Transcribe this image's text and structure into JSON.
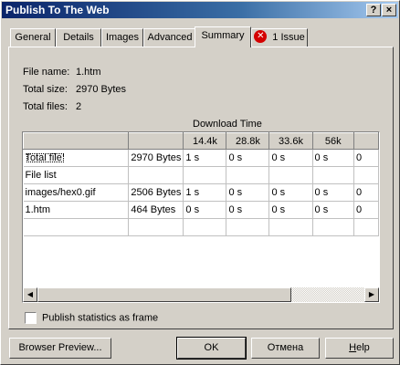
{
  "window": {
    "title": "Publish To The Web",
    "help_button": "?",
    "close_button": "×"
  },
  "tabs": [
    "General",
    "Details",
    "Images",
    "Advanced",
    "Summary"
  ],
  "issue_tab": {
    "icon": "error-icon",
    "label": "1 Issue"
  },
  "summary": {
    "file_name": {
      "label": "File name:",
      "value": "1.htm"
    },
    "total_size": {
      "label": "Total size:",
      "value": "2970 Bytes"
    },
    "total_files": {
      "label": "Total files:",
      "value": "2"
    }
  },
  "download_time_label": "Download Time",
  "table": {
    "headers": [
      "",
      "",
      "14.4k",
      "28.8k",
      "33.6k",
      "56k",
      ""
    ],
    "rows": [
      [
        "Total file:",
        "2970 Bytes",
        "1 s",
        "0 s",
        "0 s",
        "0 s",
        "0"
      ],
      [
        "File list",
        "",
        "",
        "",
        "",
        "",
        ""
      ],
      [
        "images/hex0.gif",
        "2506 Bytes",
        "1 s",
        "0 s",
        "0 s",
        "0 s",
        "0"
      ],
      [
        "1.htm",
        "464 Bytes",
        "0 s",
        "0 s",
        "0 s",
        "0 s",
        "0"
      ],
      [
        "",
        "",
        "",
        "",
        "",
        "",
        ""
      ]
    ]
  },
  "checkbox": {
    "label": "Publish statistics as frame",
    "checked": false
  },
  "buttons": {
    "browser_preview": "Browser Preview...",
    "ok": "OK",
    "cancel": "Отмена",
    "help_prefix": "",
    "help_underlined": "H",
    "help_suffix": "elp"
  },
  "colors": {
    "title_bar_start": "#0a246a",
    "title_bar_end": "#a6caf0",
    "face": "#d4d0c8",
    "error": "#d40000"
  }
}
